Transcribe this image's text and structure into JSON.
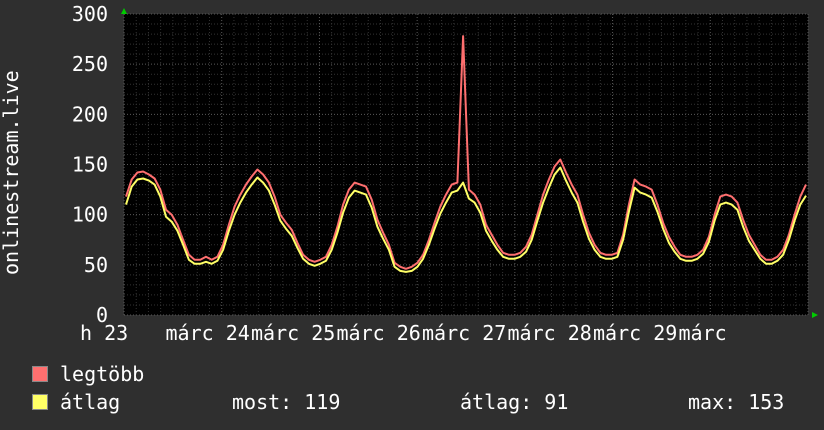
{
  "chart_data": {
    "type": "line",
    "ylabel": "onlinestream.live",
    "ylim": [
      0,
      300
    ],
    "y_ticks": [
      "0",
      "50",
      "100",
      "150",
      "200",
      "250",
      "300"
    ],
    "x_ticks": [
      "h 23",
      "márc 24",
      "márc 25",
      "márc 26",
      "márc 27",
      "márc 28",
      "márc 29",
      "márc"
    ],
    "grid": true,
    "colors": {
      "background": "#000000",
      "grid": "#444444",
      "max": "#ff6f6f",
      "avg": "#ffff66",
      "axis_arrow": "#00cc00"
    },
    "series": [
      {
        "name": "legtöbb",
        "values": [
          118,
          135,
          142,
          143,
          140,
          136,
          125,
          105,
          100,
          90,
          75,
          60,
          55,
          55,
          58,
          55,
          58,
          70,
          90,
          108,
          120,
          130,
          138,
          145,
          140,
          132,
          118,
          100,
          92,
          85,
          72,
          60,
          55,
          53,
          55,
          58,
          70,
          88,
          110,
          125,
          132,
          130,
          128,
          115,
          95,
          82,
          70,
          52,
          48,
          46,
          48,
          52,
          60,
          75,
          92,
          108,
          120,
          130,
          132,
          278,
          125,
          120,
          110,
          90,
          80,
          70,
          62,
          60,
          60,
          62,
          68,
          80,
          100,
          120,
          135,
          148,
          155,
          142,
          130,
          120,
          100,
          82,
          70,
          62,
          60,
          60,
          62,
          80,
          110,
          135,
          130,
          128,
          125,
          110,
          92,
          78,
          68,
          60,
          58,
          58,
          60,
          65,
          78,
          100,
          118,
          120,
          118,
          112,
          95,
          80,
          70,
          60,
          55,
          55,
          58,
          65,
          80,
          100,
          118,
          130
        ]
      },
      {
        "name": "átlag",
        "values": [
          110,
          128,
          135,
          136,
          134,
          130,
          118,
          98,
          93,
          84,
          70,
          55,
          51,
          51,
          53,
          51,
          54,
          65,
          84,
          100,
          112,
          122,
          130,
          137,
          132,
          124,
          110,
          94,
          86,
          79,
          67,
          56,
          51,
          49,
          51,
          54,
          65,
          82,
          102,
          117,
          124,
          122,
          120,
          107,
          88,
          76,
          65,
          48,
          44,
          43,
          44,
          48,
          56,
          70,
          86,
          101,
          112,
          122,
          124,
          132,
          116,
          112,
          102,
          84,
          74,
          65,
          58,
          56,
          56,
          58,
          63,
          75,
          94,
          112,
          127,
          140,
          147,
          134,
          122,
          112,
          93,
          76,
          65,
          58,
          56,
          56,
          58,
          75,
          103,
          127,
          122,
          120,
          117,
          103,
          86,
          72,
          63,
          56,
          54,
          54,
          56,
          61,
          73,
          94,
          110,
          112,
          110,
          105,
          88,
          74,
          65,
          56,
          51,
          51,
          54,
          60,
          75,
          94,
          110,
          119
        ]
      }
    ]
  },
  "legend": {
    "max_label": "legtöbb",
    "avg_label": "átlag"
  },
  "stats": {
    "current": "most: 119",
    "average": "átlag: 91",
    "max": "max: 153"
  }
}
